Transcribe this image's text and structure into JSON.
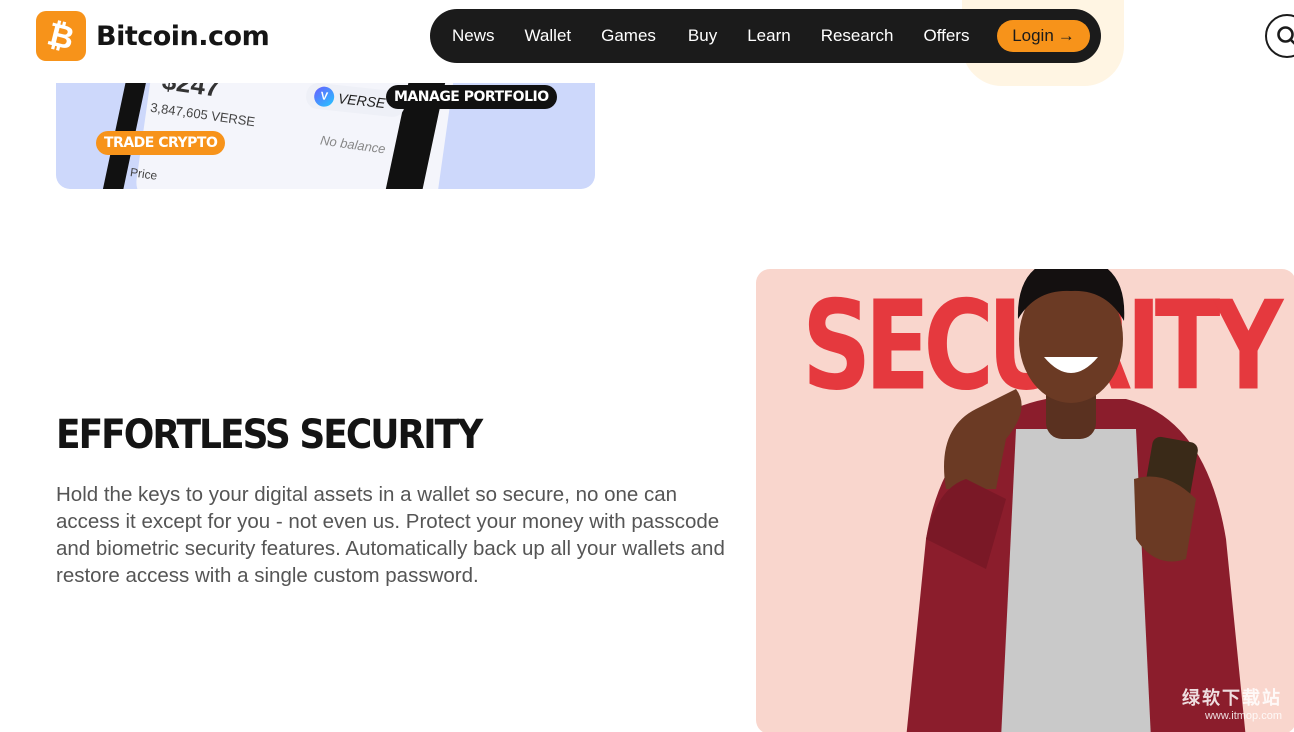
{
  "header": {
    "logo_text": "Bitcoin.com",
    "nav": [
      "News",
      "Wallet",
      "Games",
      "Buy",
      "Learn",
      "Research",
      "Offers"
    ],
    "login_label": "Login",
    "login_arrow": "→"
  },
  "promo": {
    "amount": "$247",
    "verse_balance": "3,847,605 VERSE",
    "verse_label": "VERSE",
    "no_balance": "No balance",
    "price_label": "Price",
    "tag_manage": "MANAGE PORTFOLIO",
    "tag_trade": "TRADE CRYPTO"
  },
  "section": {
    "title": "EFFORTLESS SECURITY",
    "body": "Hold the keys to your digital assets in a wallet so secure, no one can access it except for you - not even us. Protect your money with passcode and biometric security features. Automatically back up all your wallets and restore access with a single custom password."
  },
  "hero": {
    "word": "SECURITY",
    "watermark_main": "绿软下载站",
    "watermark_sub": "www.itmop.com"
  },
  "colors": {
    "brand_orange": "#f7931a",
    "nav_bg": "#1b1b1b",
    "promo_bg": "#cdd8fb",
    "hero_bg": "#f9d6cd",
    "hero_word": "#e5393e"
  },
  "icons": {
    "logo": "bitcoin-logo-icon",
    "search": "search-icon",
    "login_arrow": "arrow-right-icon"
  }
}
